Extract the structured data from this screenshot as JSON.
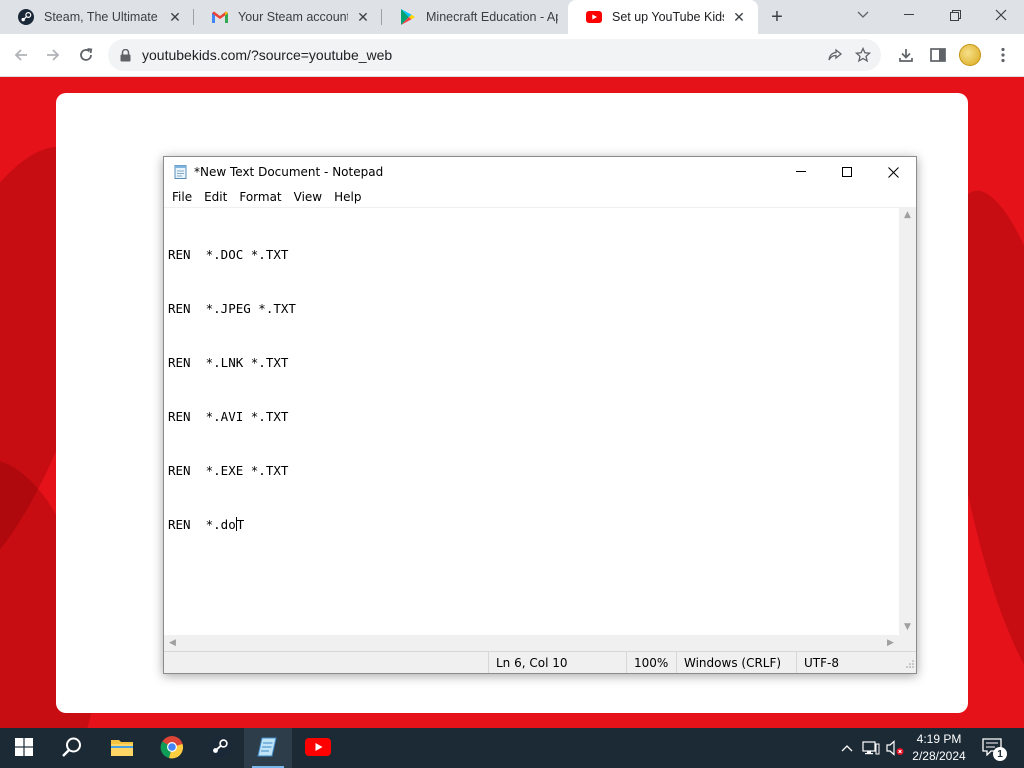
{
  "browser": {
    "tabs": [
      {
        "title": "Steam, The Ultimate Online Game Platform",
        "icon": "steam-icon",
        "active": false
      },
      {
        "title": "Your Steam account: Access from new device",
        "icon": "gmail-icon",
        "active": false
      },
      {
        "title": "Minecraft Education - Apps on Google Play",
        "icon": "google-play-icon",
        "active": false
      },
      {
        "title": "Set up YouTube Kids",
        "icon": "youtube-icon",
        "active": true
      }
    ],
    "url": "youtubekids.com/?source=youtube_web",
    "colors": {
      "page_background": "#e6121a",
      "tab_strip": "#dee1e6"
    }
  },
  "notepad": {
    "title": "*New Text Document - Notepad",
    "menu": [
      "File",
      "Edit",
      "Format",
      "View",
      "Help"
    ],
    "lines": [
      "REN  *.DOC *.TXT",
      "REN  *.JPEG *.TXT",
      "REN  *.LNK *.TXT",
      "REN  *.AVI *.TXT",
      "REN  *.EXE *.TXT"
    ],
    "last_line_before_caret": "REN  *.do",
    "last_line_after_caret": "T",
    "status": {
      "position": "Ln 6, Col 10",
      "zoom": "100%",
      "line_endings": "Windows (CRLF)",
      "encoding": "UTF-8"
    }
  },
  "taskbar": {
    "apps": [
      "start-icon",
      "search-icon",
      "file-explorer-icon",
      "chrome-icon",
      "steam-icon",
      "notepad-icon",
      "youtube-icon"
    ],
    "time": "4:19 PM",
    "date": "2/28/2024",
    "notification_count": "1"
  }
}
